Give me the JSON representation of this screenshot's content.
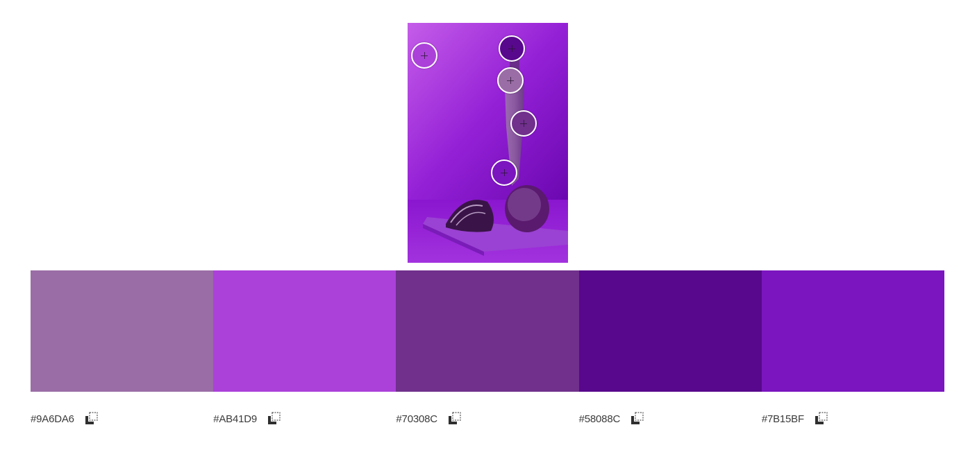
{
  "swatches": [
    {
      "hex": "#9A6DA6",
      "color": "#9A6DA6"
    },
    {
      "hex": "#AB41D9",
      "color": "#AB41D9"
    },
    {
      "hex": "#70308C",
      "color": "#70308C"
    },
    {
      "hex": "#58088C",
      "color": "#58088C"
    },
    {
      "hex": "#7B15BF",
      "color": "#7B15BF"
    }
  ],
  "pickers": [
    {
      "color": "#AB41D9"
    },
    {
      "color": "#58088C"
    },
    {
      "color": "#9A6DA6"
    },
    {
      "color": "#70308C"
    },
    {
      "color": "#7B15BF"
    }
  ],
  "icons": {
    "copy": "copy-icon",
    "picker": "crosshair-icon"
  }
}
